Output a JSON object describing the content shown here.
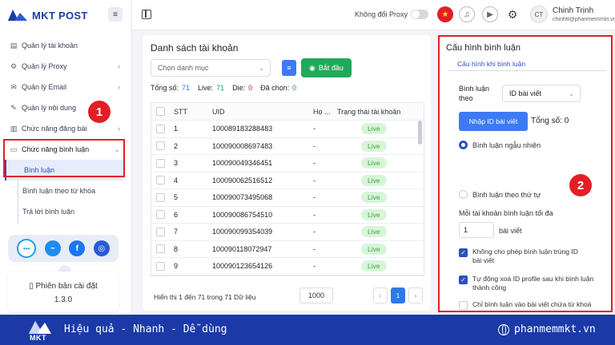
{
  "app": {
    "brand": "MKT POST"
  },
  "header": {
    "proxy_label": "Không đổi Proxy",
    "user_name": "Chinh Trịnh",
    "user_email": "chinhtt@phanmemmkt.vn",
    "avatar_initials": "CT"
  },
  "sidebar": {
    "items": [
      {
        "label": "Quản lý tài khoản",
        "icon": "users-icon"
      },
      {
        "label": "Quản lý Proxy",
        "icon": "network-icon"
      },
      {
        "label": "Quản lý Email",
        "icon": "email-icon"
      },
      {
        "label": "Quản lý nội dung",
        "icon": "content-icon"
      },
      {
        "label": "Chức năng đăng bài",
        "icon": "post-icon"
      },
      {
        "label": "Chức năng bình luận",
        "icon": "comment-icon"
      }
    ],
    "subitems": [
      {
        "label": "Bình luận"
      },
      {
        "label": "Bình luận theo từ khóa"
      },
      {
        "label": "Trả lời bình luận"
      }
    ],
    "version_label": "Phiên bản cài đặt",
    "version_value": "1.3.0"
  },
  "accounts": {
    "title": "Danh sách tài khoản",
    "category_placeholder": "Chọn danh mục",
    "start_label": "Bắt đầu",
    "stats": {
      "total_label": "Tổng số:",
      "total": "71",
      "live_label": "Live:",
      "live": "71",
      "die_label": "Die:",
      "die": "0",
      "selected_label": "Đã chọn:",
      "selected": "0"
    },
    "columns": [
      "STT",
      "UID",
      "Họ ...",
      "Trạng thái tài khoản"
    ],
    "rows": [
      {
        "stt": "1",
        "uid": "100089183288483",
        "name": "-",
        "status": "Live"
      },
      {
        "stt": "2",
        "uid": "100090008697483",
        "name": "-",
        "status": "Live"
      },
      {
        "stt": "3",
        "uid": "100090049346451",
        "name": "-",
        "status": "Live"
      },
      {
        "stt": "4",
        "uid": "100090062516512",
        "name": "-",
        "status": "Live"
      },
      {
        "stt": "5",
        "uid": "100090073495068",
        "name": "-",
        "status": "Live"
      },
      {
        "stt": "6",
        "uid": "100090086754510",
        "name": "-",
        "status": "Live"
      },
      {
        "stt": "7",
        "uid": "100090099354039",
        "name": "-",
        "status": "Live"
      },
      {
        "stt": "8",
        "uid": "100090118072947",
        "name": "-",
        "status": "Live"
      },
      {
        "stt": "9",
        "uid": "100090123654126",
        "name": "-",
        "status": "Live"
      }
    ],
    "footer_info": "Hiển thị 1 đến 71 trong 71 Dữ liệu",
    "page_size": "1000",
    "current_page": "1"
  },
  "config": {
    "title": "Cấu hình bình luận",
    "tab": "Cấu hình khi bình luận",
    "comment_by_label": "Bình luận theo",
    "comment_by_value": "ID bài viết",
    "import_label": "Nhập ID bài viết",
    "total_label": "Tổng số: 0",
    "radio_random": "Bình luận ngẫu nhiên",
    "radio_order": "Bình luận theo thứ tự",
    "max_label": "Mỗi tài khoản bình luận tối đa",
    "max_value": "1",
    "max_unit": "bài viết",
    "chk_no_duplicate": "Không cho phép bình luận trùng ID bài viết",
    "chk_auto_delete": "Tự động xoá ID profile sau khi bình luận thành công",
    "chk_keyword": "Chỉ bình luận vào bài viết chứa từ khoá"
  },
  "annotations": {
    "badge1": "1",
    "badge2": "2"
  },
  "banner": {
    "logo_text": "MKT",
    "slogan": "Hiệu quả - Nhanh - Dễ dùng",
    "website": "phanmemmkt.vn"
  },
  "colors": {
    "brand_blue": "#1b3aa8",
    "accent": "#2c4fc2",
    "highlight_red": "#e31e24",
    "live_green": "#3aa53a",
    "start_green": "#1faa59"
  }
}
